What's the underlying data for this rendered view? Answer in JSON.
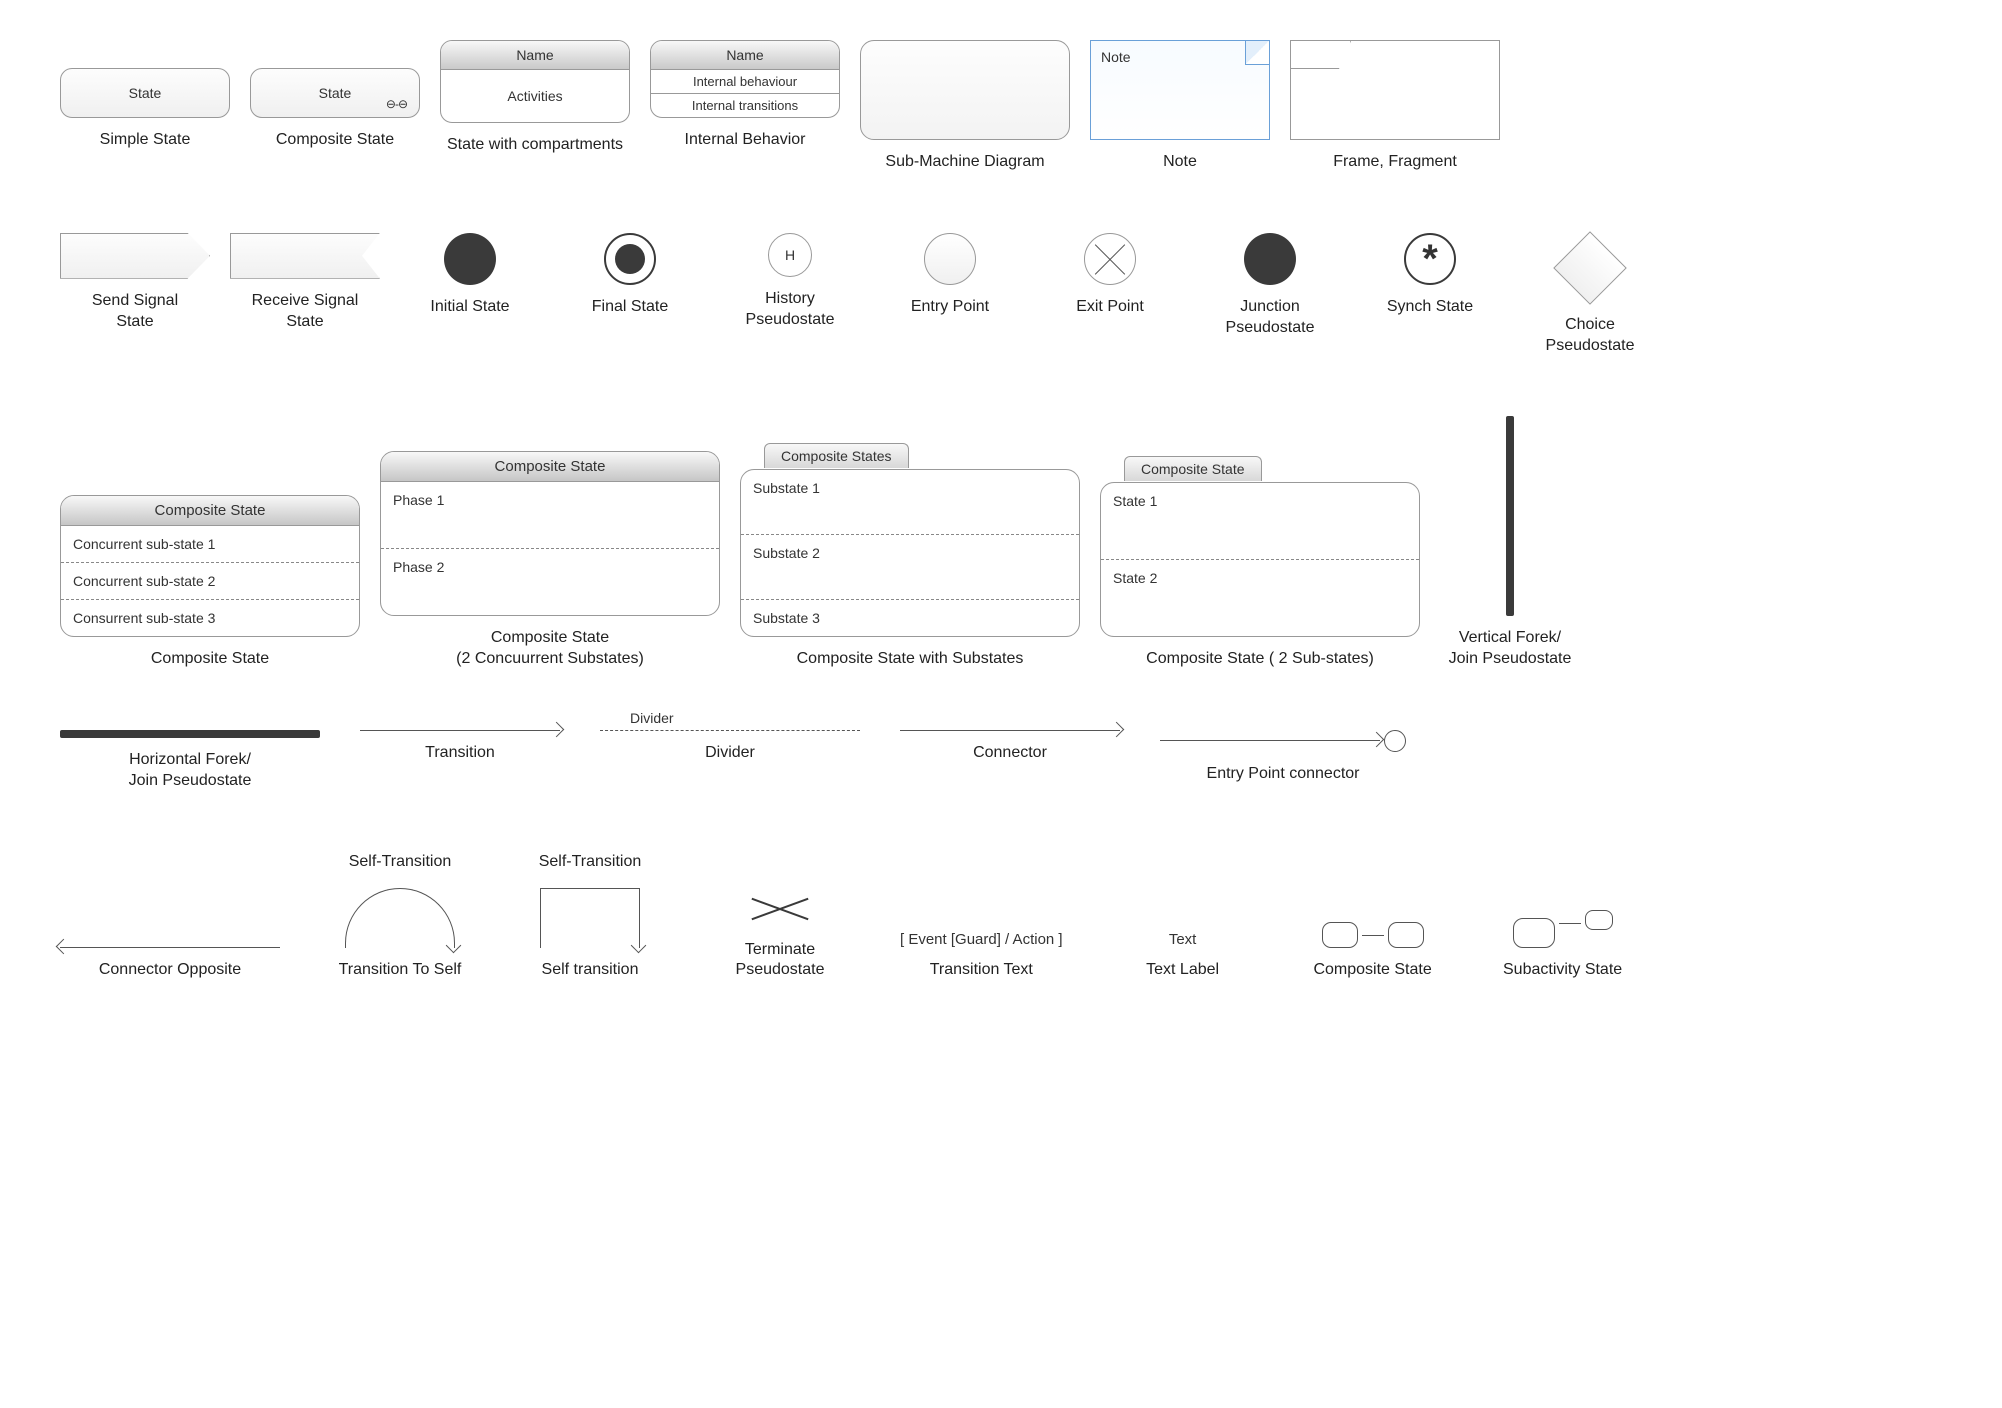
{
  "row1": {
    "simpleState": {
      "text": "State",
      "caption": "Simple State"
    },
    "compositeStateSmall": {
      "text": "State",
      "glyph": "⊖-⊖",
      "caption": "Composite State"
    },
    "compartments": {
      "name": "Name",
      "activities": "Activities",
      "caption": "State with compartments"
    },
    "internalBehavior": {
      "name": "Name",
      "line1": "Internal behaviour",
      "line2": "Internal transitions",
      "caption": "Internal Behavior"
    },
    "submachine": {
      "caption": "Sub-Machine Diagram"
    },
    "note": {
      "text": "Note",
      "caption": "Note"
    },
    "frame": {
      "caption": "Frame, Fragment"
    }
  },
  "row2": {
    "sendSignal": {
      "caption": "Send Signal\nState"
    },
    "recvSignal": {
      "caption": "Receive Signal\nState"
    },
    "initial": {
      "caption": "Initial State"
    },
    "final": {
      "caption": "Final State"
    },
    "history": {
      "letter": "H",
      "caption": "History\nPseudostate"
    },
    "entry": {
      "caption": "Entry Point"
    },
    "exit": {
      "caption": "Exit Point"
    },
    "junction": {
      "caption": "Junction\nPseudostate"
    },
    "synch": {
      "glyph": "*",
      "caption": "Synch State"
    },
    "choice": {
      "caption": "Choice\nPseudostate"
    }
  },
  "row3": {
    "comp3": {
      "title": "Composite State",
      "r1": "Concurrent sub-state 1",
      "r2": "Concurrent sub-state 2",
      "r3": "Consurrent sub-state 3",
      "caption": "Composite State"
    },
    "comp2": {
      "title": "Composite State",
      "r1": "Phase 1",
      "r2": "Phase 2",
      "caption": "Composite State\n(2 Concuurrent Substates)"
    },
    "compTab3": {
      "tab": "Composite States",
      "r1": "Substate 1",
      "r2": "Substate 2",
      "r3": "Substate 3",
      "caption": "Composite State with Substates"
    },
    "compTab2": {
      "tab": "Composite State",
      "r1": "State 1",
      "r2": "State 2",
      "caption": "Composite State ( 2 Sub-states)"
    },
    "vbar": {
      "caption": "Vertical Forek/\nJoin Pseudostate"
    }
  },
  "row4": {
    "hbar": {
      "caption": "Horizontal Forek/\nJoin Pseudostate"
    },
    "transition": {
      "caption": "Transition"
    },
    "divider": {
      "label": "Divider",
      "caption": "Divider"
    },
    "connector": {
      "caption": "Connector"
    },
    "entryConn": {
      "caption": "Entry Point connector"
    }
  },
  "row5": {
    "connOpp": {
      "caption": "Connector Opposite"
    },
    "toSelf": {
      "label": "Self-Transition",
      "caption": "Transition To Self"
    },
    "selfTrans": {
      "label": "Self-Transition",
      "caption": "Self transition"
    },
    "terminate": {
      "caption": "Terminate\nPseudostate"
    },
    "transText": {
      "text": "[ Event [Guard] / Action ]",
      "caption": "Transition Text"
    },
    "textLabel": {
      "text": "Text",
      "caption": "Text Label"
    },
    "miniComp": {
      "caption": "Composite State"
    },
    "subact": {
      "caption": "Subactivity State"
    }
  }
}
